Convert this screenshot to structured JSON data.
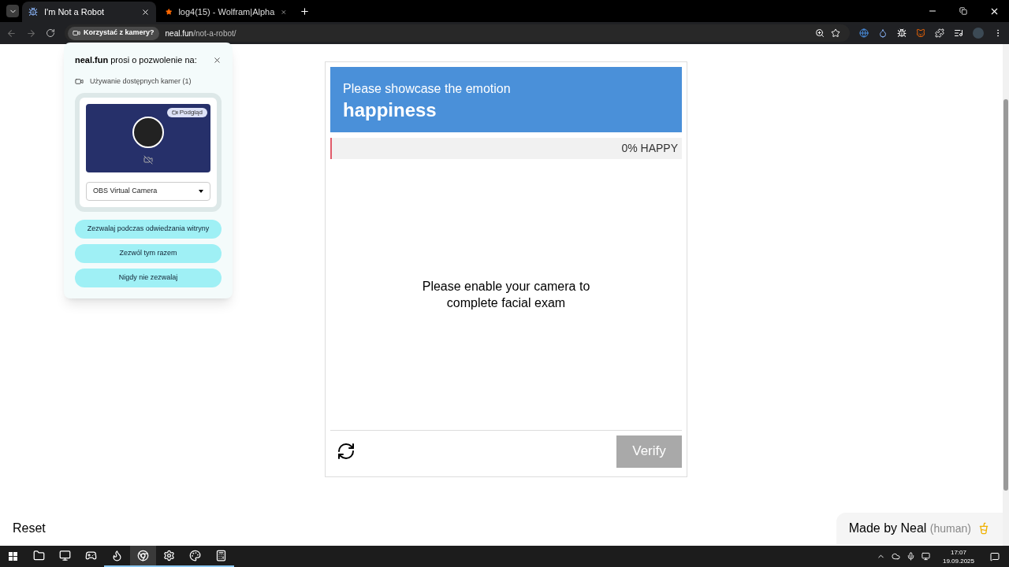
{
  "browser": {
    "tabs": [
      {
        "title": "I'm Not a Robot",
        "selected": true
      },
      {
        "title": "log4(15) - Wolfram|Alpha",
        "selected": false
      }
    ],
    "camera_chip": "Korzystać z kamery?",
    "url_host": "neal.fun",
    "url_path": "/not-a-robot/"
  },
  "permission_popup": {
    "site": "neal.fun",
    "title_rest": " prosi o pozwolenie na:",
    "permission": "Używanie dostępnych kamer (1)",
    "preview_badge": "Podgląd",
    "camera_select": "OBS Virtual Camera",
    "buttons": [
      "Zezwalaj podczas odwiedzania witryny",
      "Zezwól tym razem",
      "Nigdy nie zezwalaj"
    ]
  },
  "challenge": {
    "prompt": "Please showcase the emotion",
    "emotion": "happiness",
    "meter": {
      "level": 0,
      "reading": "0% HAPPY"
    },
    "message": "Please enable your camera to complete facial exam",
    "verify": {
      "label": "Verify",
      "disabled": true
    }
  },
  "reset": "Reset",
  "credit": {
    "text": "Made by Neal",
    "note": "(human)"
  },
  "taskbar": {
    "apps": [
      {
        "running": false,
        "selected": false
      },
      {
        "running": false,
        "selected": false
      },
      {
        "running": false,
        "selected": false
      },
      {
        "running": true,
        "selected": false
      },
      {
        "running": true,
        "selected": true
      },
      {
        "running": true,
        "selected": false
      },
      {
        "running": true,
        "selected": false
      },
      {
        "running": true,
        "selected": false
      }
    ],
    "time": "17:07",
    "date": "19.09.2025"
  }
}
